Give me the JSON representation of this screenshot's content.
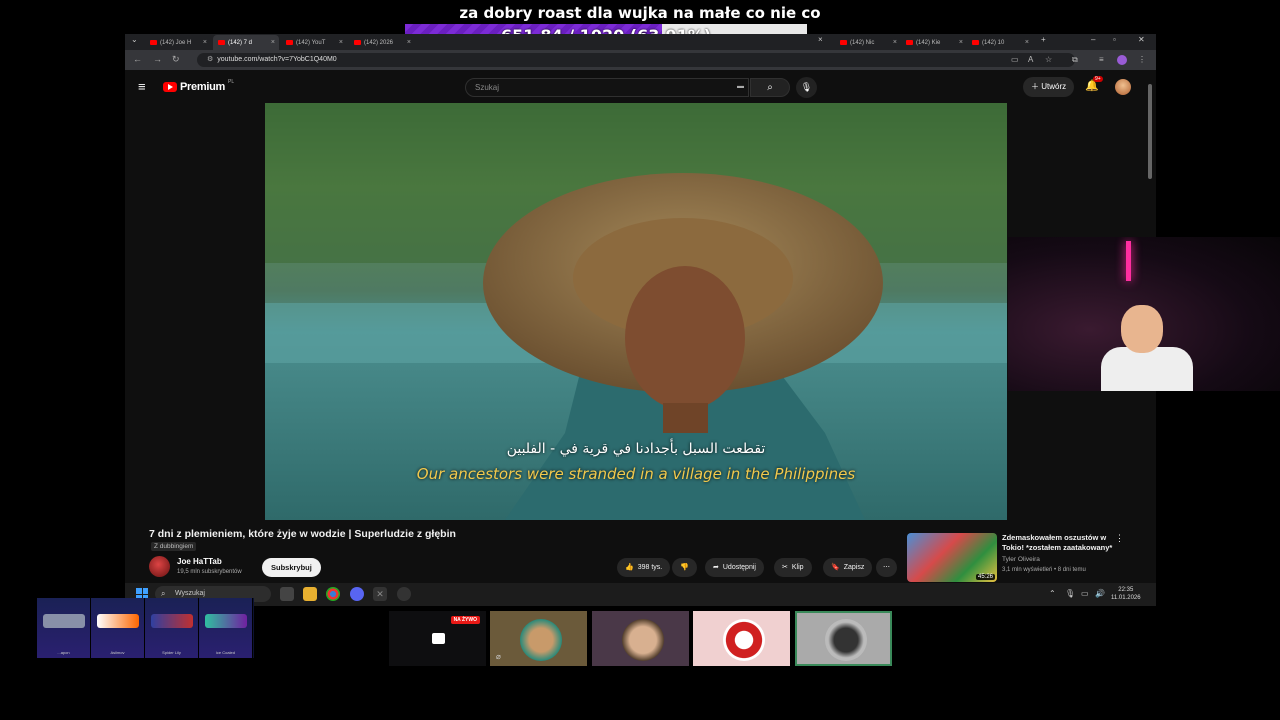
{
  "overlay": {
    "title": "za dobry roast dla wujka na małe co nie co",
    "goal_text": "651.84 / 1020 (63.91%)",
    "goal_fraction": 0.6391
  },
  "browser": {
    "tabs": [
      {
        "label": "(142) Joe H"
      },
      {
        "label": "(142) 7 d"
      },
      {
        "label": "(142) YouT"
      },
      {
        "label": "(142) 2026"
      },
      {
        "label": "(142) Nic"
      },
      {
        "label": "(142) Kie"
      },
      {
        "label": "(142) 10"
      }
    ],
    "url": "youtube.com/watch?v=7YobC1Q40M0"
  },
  "youtube": {
    "logo_text": "Premium",
    "logo_region": "PL",
    "search_placeholder": "Szukaj",
    "create_label": "Utwórz",
    "notifications_badge": "9+",
    "subtitle_arabic": "تقطعت السبل بأجدادنا في قرية في - الفلبين",
    "subtitle_english": "Our ancestors were stranded in a village in the Philippines",
    "video_title": "7 dni z plemieniem, które żyje w wodzie | Superludzie z głębin",
    "dub_tag": "Z dubbingiem",
    "channel_name": "Joe HaTTab",
    "channel_subs": "19,5 mln subskrybentów",
    "subscribe_label": "Subskrybuj",
    "likes": "398 tys.",
    "share_label": "Udostępnij",
    "clip_label": "Klip",
    "save_label": "Zapisz",
    "recommended": {
      "title": "Zdemaskowałem oszustów w Tokio! *zostałem zaatakowany*",
      "channel": "Tyler Oliveira",
      "meta": "3,1 mln wyświetleń • 8 dni temu",
      "duration": "45:26"
    }
  },
  "taskbar": {
    "search_placeholder": "Wyszukaj",
    "time": "22:35",
    "date": "11.01.2026"
  },
  "bottom_overlay": {
    "skins": [
      "...apon",
      "Asiimov",
      "Spider Lily",
      "ice Coaled"
    ],
    "live_badge": "NA ŻYWO"
  },
  "colors": {
    "goal_fill": "#7c2bd6",
    "youtube_red": "#ff0000",
    "subtitle_yellow": "#f2c94c",
    "neon_pink": "#ff2ea0"
  }
}
